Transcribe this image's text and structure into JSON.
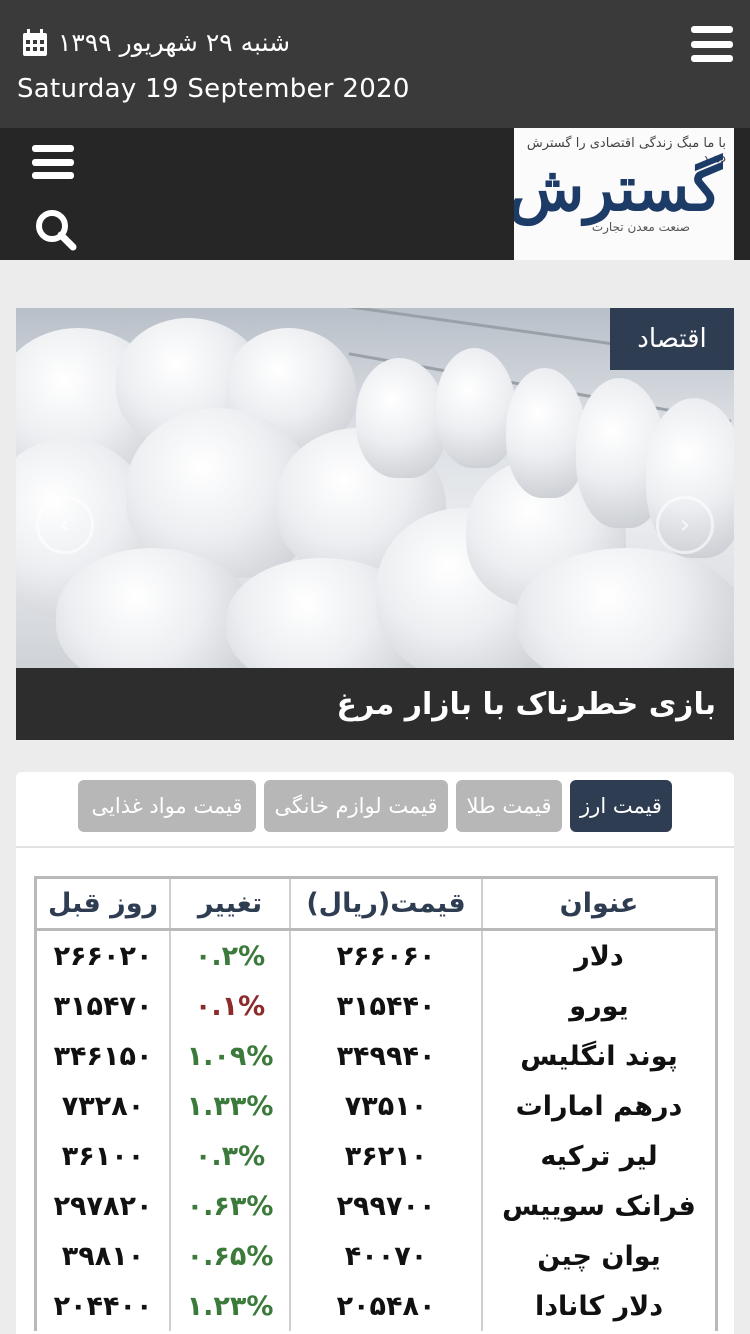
{
  "header": {
    "date_fa": "شنبه ۲۹ شهریور ۱۳۹۹",
    "date_en": "Saturday 19 September 2020"
  },
  "logo": {
    "tagline": "با ما مبگ زندگی اقتصادی را گسترش دهید",
    "name": "گسترش",
    "subtitle": "صنعت معدن تجارت"
  },
  "hero": {
    "category": "اقتصاد",
    "caption": "بازی خطرناک با بازار مرغ"
  },
  "tabs": [
    {
      "label": "قیمت ارز",
      "active": true
    },
    {
      "label": "قیمت طلا",
      "active": false
    },
    {
      "label": "قیمت لوازم خانگی",
      "active": false
    },
    {
      "label": "قیمت مواد غذایی",
      "active": false
    }
  ],
  "price_table": {
    "headers": {
      "title": "عنوان",
      "price": "قیمت(ریال)",
      "change": "تغییر",
      "prev": "روز قبل"
    },
    "rows": [
      {
        "title": "دلار",
        "price": "۲۶۶۰۶۰",
        "change": "۰.۲%",
        "trend": "up",
        "prev": "۲۶۶۰۲۰"
      },
      {
        "title": "یورو",
        "price": "۳۱۵۴۴۰",
        "change": "۰.۱%",
        "trend": "down",
        "prev": "۳۱۵۴۷۰"
      },
      {
        "title": "پوند انگلیس",
        "price": "۳۴۹۹۴۰",
        "change": "۱.۰۹%",
        "trend": "up",
        "prev": "۳۴۶۱۵۰"
      },
      {
        "title": "درهم امارات",
        "price": "۷۳۵۱۰",
        "change": "۱.۳۳%",
        "trend": "up",
        "prev": "۷۳۲۸۰"
      },
      {
        "title": "لیر ترکیه",
        "price": "۳۶۲۱۰",
        "change": "۰.۳%",
        "trend": "up",
        "prev": "۳۶۱۰۰"
      },
      {
        "title": "فرانک سوییس",
        "price": "۲۹۹۷۰۰",
        "change": "۰.۶۳%",
        "trend": "up",
        "prev": "۲۹۷۸۲۰"
      },
      {
        "title": "یوان چین",
        "price": "۴۰۰۷۰",
        "change": "۰.۶۵%",
        "trend": "up",
        "prev": "۳۹۸۱۰"
      },
      {
        "title": "دلار کانادا",
        "price": "۲۰۵۴۸۰",
        "change": "۱.۲۳%",
        "trend": "up",
        "prev": "۲۰۴۴۰۰"
      }
    ]
  },
  "colors": {
    "accent": "#2f3d52",
    "up": "#3b7a3b",
    "down": "#8e2a2a"
  }
}
